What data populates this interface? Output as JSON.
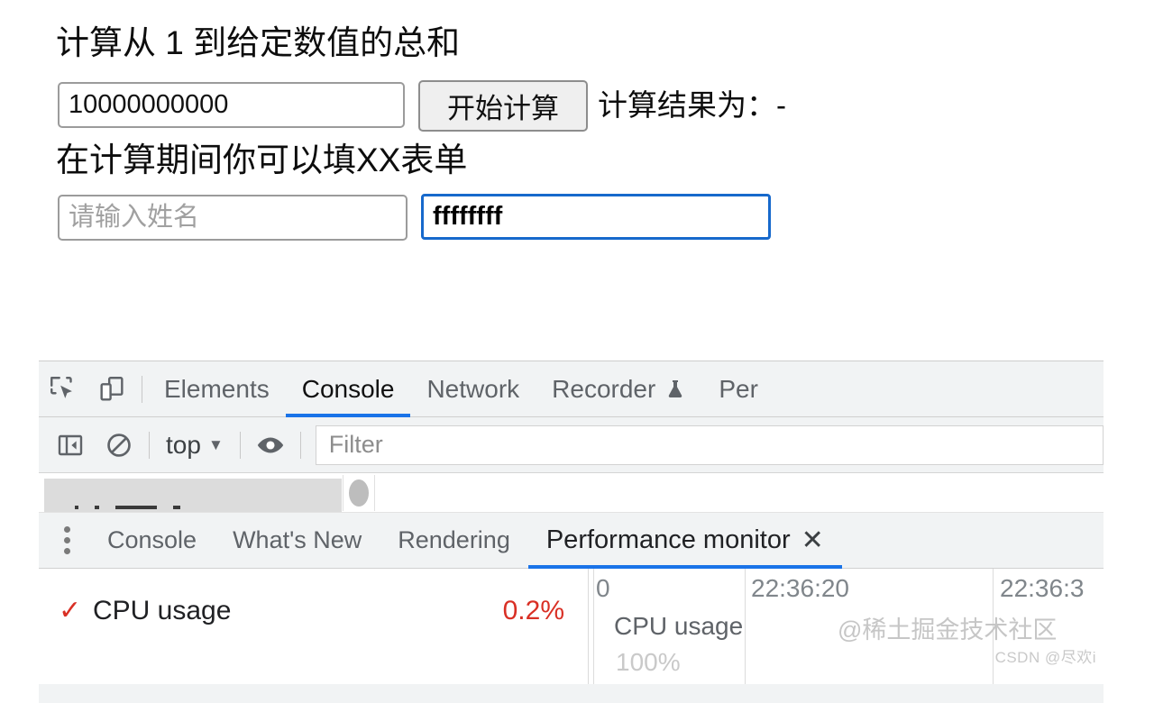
{
  "page": {
    "heading_main": "计算从 1 到给定数值的总和",
    "number_input_value": "10000000000",
    "calc_button_label": "开始计算",
    "result_text": "计算结果为：-",
    "heading_secondary": "在计算期间你可以填XX表单",
    "name_placeholder": "请输入姓名",
    "name_value": "",
    "extra_input_value": "ffffffff",
    "focus_color": "#1769cc"
  },
  "devtools": {
    "main_tabs": [
      {
        "label": "Elements",
        "active": false,
        "icon": ""
      },
      {
        "label": "Console",
        "active": true,
        "icon": ""
      },
      {
        "label": "Network",
        "active": false,
        "icon": ""
      },
      {
        "label": "Recorder",
        "active": false,
        "icon": "flask-icon"
      },
      {
        "label": "Per",
        "active": false,
        "icon": ""
      }
    ],
    "toolbar_icons": [
      "inspect-element-icon",
      "device-toolbar-icon"
    ],
    "console_toolbar": {
      "sidebar_toggle_icon": "sidebar-toggle-icon",
      "clear_icon": "clear-console-icon",
      "context_label": "top",
      "context_caret": "▼",
      "eye_icon": "live-expression-icon",
      "filter_placeholder": "Filter"
    },
    "drawer_tabs": [
      {
        "label": "Console",
        "active": false
      },
      {
        "label": "What's New",
        "active": false
      },
      {
        "label": "Rendering",
        "active": false
      },
      {
        "label": "Performance monitor",
        "active": true
      }
    ],
    "drawer_close_label": "✕",
    "accent_color": "#1a73e8"
  },
  "performance_monitor": {
    "metrics": [
      {
        "checked": "✓",
        "name": "CPU usage",
        "value": "0.2%",
        "color": "#d93025"
      }
    ],
    "chart": {
      "title": "CPU usage",
      "max_label": "100%",
      "time_labels": [
        "0",
        "22:36:20",
        "22:36:3"
      ]
    }
  },
  "watermarks": {
    "juejin": "@稀土掘金技术社区",
    "csdn": "CSDN @尽欢i"
  },
  "chart_data": {
    "type": "line",
    "title": "CPU usage",
    "xlabel": "",
    "ylabel": "%",
    "ylim": [
      0,
      100
    ],
    "x": [
      "22:36:20",
      "22:36:3"
    ],
    "series": [
      {
        "name": "CPU usage",
        "values": [
          0.2
        ]
      }
    ],
    "current_value": 0.2,
    "units": "%",
    "grid": true,
    "legend": "none"
  }
}
